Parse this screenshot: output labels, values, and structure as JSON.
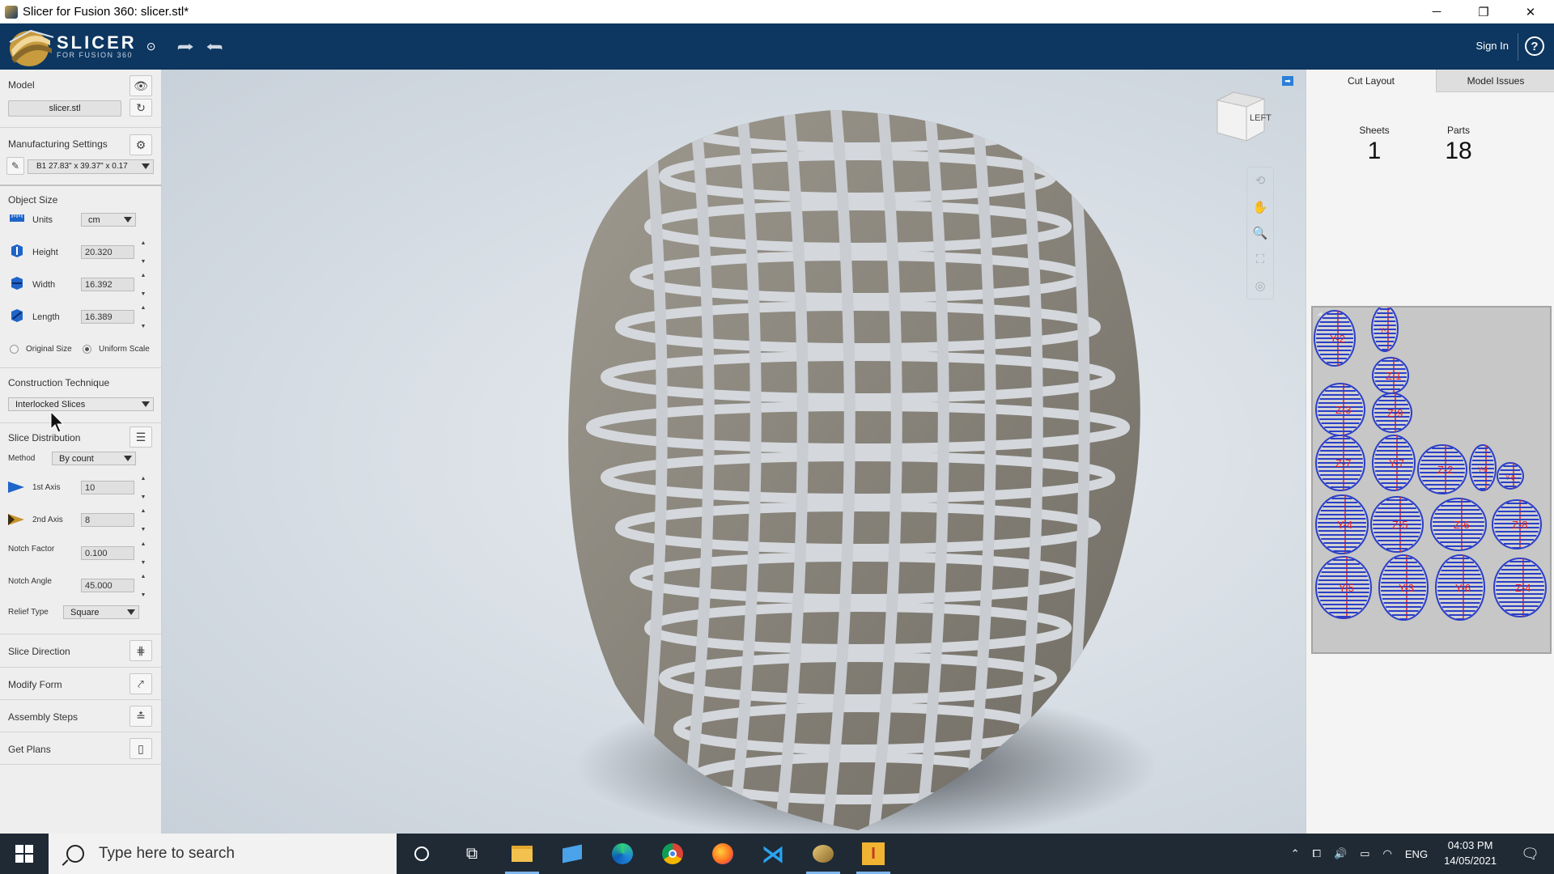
{
  "window": {
    "title": "Slicer for Fusion 360: slicer.stl*",
    "controls": [
      "─",
      "❐",
      "✕"
    ]
  },
  "brand": {
    "name": "SLICER",
    "sub": "FOR FUSION 360"
  },
  "topbar": {
    "signin": "Sign In",
    "help": "?"
  },
  "left": {
    "model_label": "Model",
    "model_file": "slicer.stl",
    "manufacturing_label": "Manufacturing Settings",
    "material": "B1 27.83\" x 39.37\" x 0.17",
    "object_size_label": "Object Size",
    "units_label": "Units",
    "units_value": "cm",
    "height_label": "Height",
    "height_value": "20.320",
    "width_label": "Width",
    "width_value": "16.392",
    "length_label": "Length",
    "length_value": "16.389",
    "original_size": "Original Size",
    "uniform_scale": "Uniform Scale",
    "construction_label": "Construction Technique",
    "construction_value": "Interlocked Slices",
    "slice_dist_label": "Slice Distribution",
    "method_label": "Method",
    "method_value": "By count",
    "axis1_label": "1st Axis",
    "axis1_value": "10",
    "axis2_label": "2nd Axis",
    "axis2_value": "8",
    "notch_factor_label": "Notch Factor",
    "notch_factor_value": "0.100",
    "notch_angle_label": "Notch Angle",
    "notch_angle_value": "45.000",
    "relief_label": "Relief Type",
    "relief_value": "Square",
    "slice_direction": "Slice Direction",
    "modify_form": "Modify Form",
    "assembly_steps": "Assembly Steps",
    "get_plans": "Get Plans"
  },
  "viewcube": {
    "face": "LEFT"
  },
  "right": {
    "tab_cut_layout": "Cut Layout",
    "tab_model_issues": "Model Issues",
    "sheets_label": "Sheets",
    "sheets_value": "1",
    "parts_label": "Parts",
    "parts_value": "18",
    "sheet_number": "1"
  },
  "parts": [
    "Y-2",
    "Y-1",
    "Z-1",
    "Z-3",
    "Z-9",
    "Z-7",
    "Y-7",
    "Z-2",
    "Y-8",
    "Y-9",
    "Y-4",
    "Z-5",
    "Z-6",
    "Z-8",
    "Y-5",
    "Y-3",
    "Y-6",
    "Z-4"
  ],
  "taskbar": {
    "search_placeholder": "Type here to search",
    "lang": "ENG",
    "time": "04:03 PM",
    "date": "14/05/2021"
  },
  "colors": {
    "topbar": "#0d3660",
    "panel": "#eeeeee",
    "part_fill": "#2c3fc7",
    "part_label": "#e02020"
  }
}
